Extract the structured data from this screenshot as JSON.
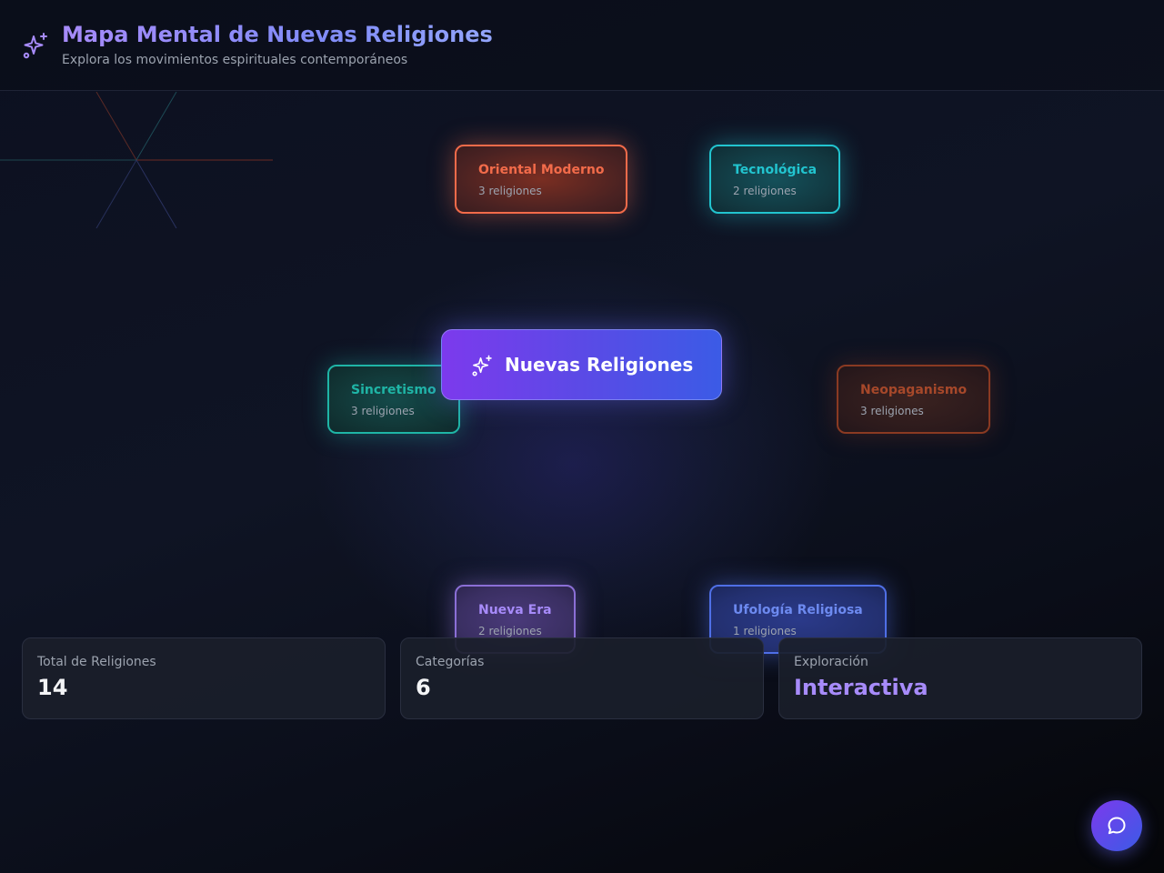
{
  "header": {
    "title": "Mapa Mental de Nuevas Religiones",
    "subtitle": "Explora los movimientos espirituales contemporáneos",
    "icon": "sparkles-icon"
  },
  "mind_map": {
    "center": {
      "label": "Nuevas Religiones",
      "icon": "sparkles-icon",
      "gradient": [
        "#7c3aed",
        "#3b5be6"
      ]
    },
    "categories": [
      {
        "title": "Oriental Moderno",
        "count": "3 religiones",
        "color": "#f26b4a"
      },
      {
        "title": "Tecnológica",
        "count": "2 religiones",
        "color": "#22c4cf"
      },
      {
        "title": "Sincretismo",
        "count": "3 religiones",
        "color": "#1fb5a6"
      },
      {
        "title": "Neopaganismo",
        "count": "3 religiones",
        "color": "#a6482a"
      },
      {
        "title": "Nueva Era",
        "count": "2 religiones",
        "color": "#a78bfa"
      },
      {
        "title": "Ufología Religiosa",
        "count": "1 religiones",
        "color": "#6d8af0"
      }
    ]
  },
  "stats": [
    {
      "label": "Total de Religiones",
      "value": "14"
    },
    {
      "label": "Categorías",
      "value": "6"
    },
    {
      "label": "Exploración",
      "value": "Interactiva"
    }
  ],
  "chat_button": {
    "icon": "chat-bubble-icon"
  }
}
